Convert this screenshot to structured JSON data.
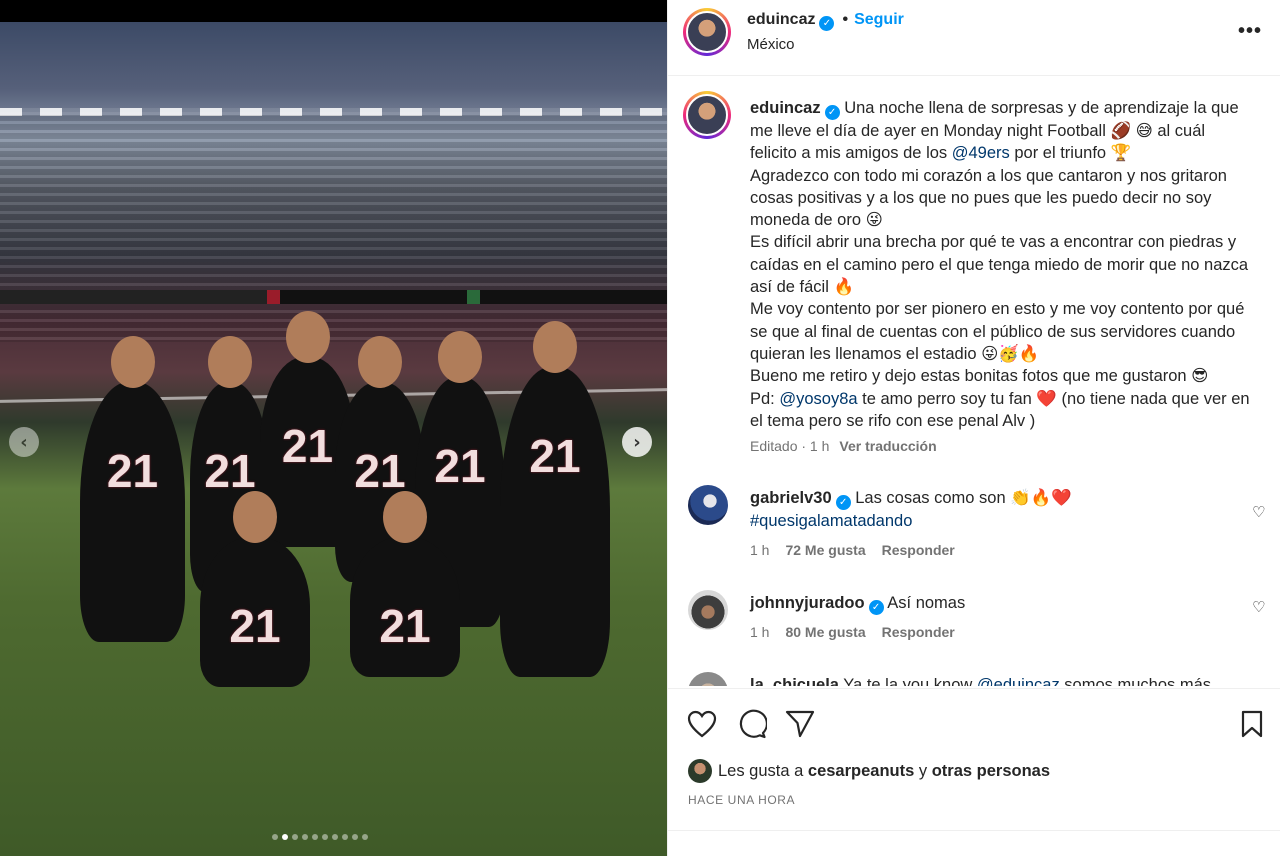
{
  "header": {
    "username": "eduincaz",
    "separator": "•",
    "follow_label": "Seguir",
    "location": "México",
    "more_label": "•••"
  },
  "caption": {
    "username": "eduincaz",
    "text_1": "Una noche llena de sorpresas y de aprendizaje la que me lleve el día de ayer en Monday night Football 🏈 😅 al cuál felicito a mis amigos de los ",
    "mention_1": "@49ers",
    "text_2": " por el triunfo 🏆\nAgradezco con todo mi corazón a los que cantaron y nos gritaron cosas positivas y a los que no pues que les puedo decir no soy moneda de oro 😜\nEs difícil abrir una brecha por qué te vas a encontrar con piedras y caídas en el camino pero el que tenga miedo de morir que no nazca así de fácil 🔥\nMe voy contento por ser pionero en esto y me voy contento por qué se que al final de cuentas con el público de sus servidores cuando quieran les llenamos el estadio 😜🥳🔥\nBueno me retiro y dejo estas bonitas fotos que me gustaron 😎\nPd: ",
    "mention_2": "@yosoy8a",
    "text_3": " te amo perro soy tu fan ❤️ (no tiene nada que ver en el tema pero se rifo con ese penal Alv )",
    "edited": "Editado · 1 h",
    "translate": "Ver traducción"
  },
  "comments": [
    {
      "username": "gabrielv30",
      "text": "Las cosas como son 👏🔥❤️",
      "hashtag": "#quesigalamatadando",
      "time": "1 h",
      "likes": "72 Me gusta",
      "reply": "Responder"
    },
    {
      "username": "johnnyjuradoo",
      "text": "Así nomas",
      "time": "1 h",
      "likes": "80 Me gusta",
      "reply": "Responder"
    },
    {
      "username": "la_chicuela",
      "text": "Ya te la you know ",
      "mention": "@eduincaz",
      "text_2": " somos muchos más"
    }
  ],
  "likes_line": {
    "prefix": "Les gusta a ",
    "user": "cesarpeanuts",
    "middle": " y ",
    "others": "otras personas"
  },
  "timestamp": "HACE UNA HORA",
  "media": {
    "jersey_number": "21",
    "carousel_count": 10,
    "carousel_active_index": 1
  },
  "colors": {
    "link": "#0095f6",
    "mention": "#00376b",
    "verified": "#0095f6",
    "secondary_text": "#737373"
  }
}
